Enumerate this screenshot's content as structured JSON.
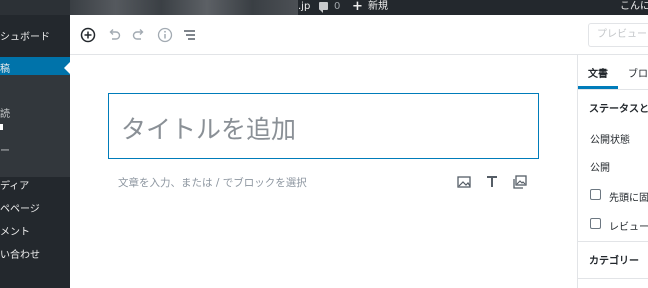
{
  "admin_bar": {
    "site_suffix": ".jp",
    "comments_count": "0",
    "new_label": "新規",
    "greeting": "こんに"
  },
  "sidebar": {
    "dashboard": "シュボード",
    "active_item": "稿",
    "sub_items": [
      "読",
      "",
      "ー"
    ],
    "items": [
      "ディア",
      "ペページ",
      "メント",
      "い合わせ"
    ]
  },
  "toolbar": {
    "preview_label": "プレビュー"
  },
  "editor": {
    "title_placeholder": "タイトルを追加",
    "block_hint": "文章を入力、または / でブロックを選択"
  },
  "panel": {
    "tab_document": "文書",
    "tab_block": "ブロック",
    "status_heading": "ステータスと公",
    "visibility_label": "公開状態",
    "publish_label": "公開",
    "sticky_label": "先頭に固定",
    "review_label": "レビューを",
    "category_heading": "カテゴリー"
  },
  "colors": {
    "admin_bg": "#23282d",
    "active_menu": "#0073aa",
    "accent": "#007cba"
  }
}
